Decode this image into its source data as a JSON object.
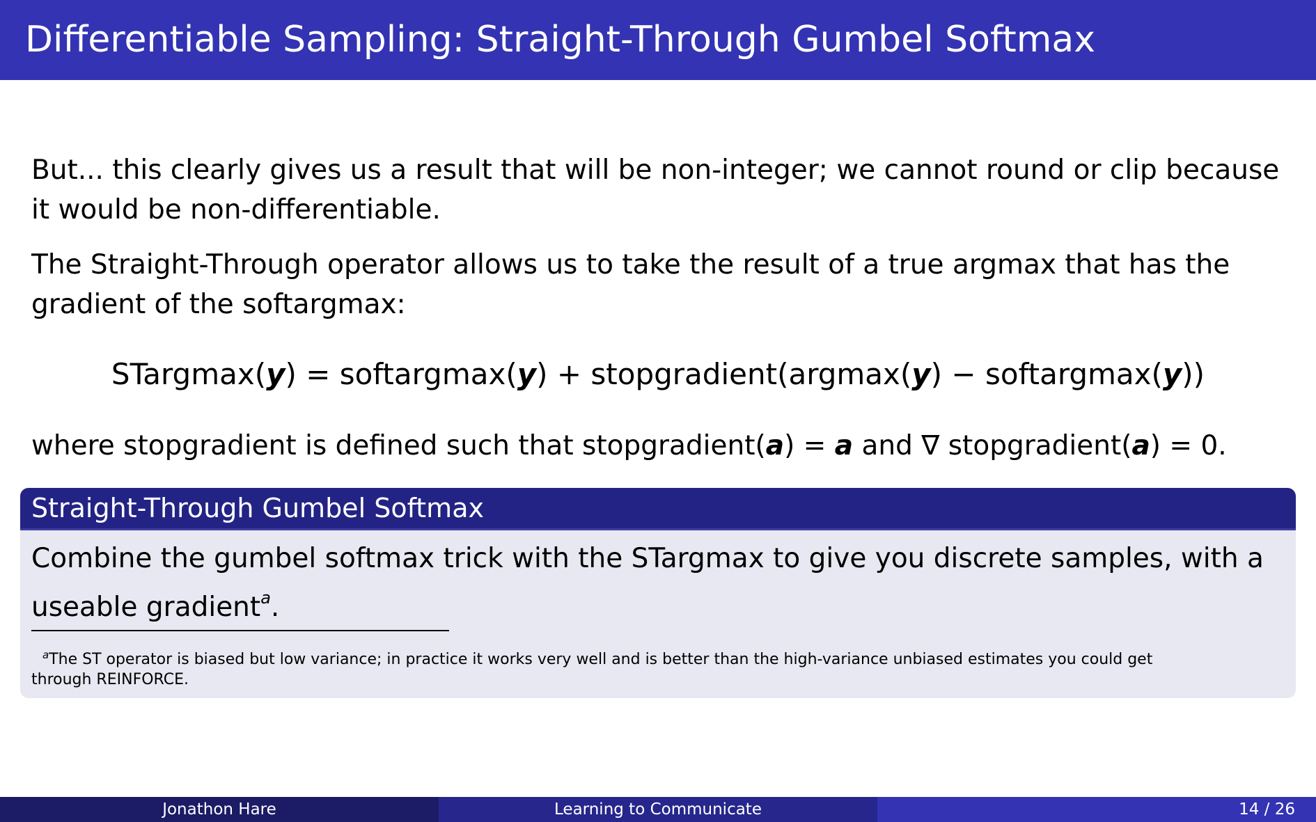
{
  "slide": {
    "title": "Differentiable Sampling: Straight-Through Gumbel Softmax",
    "para1": "But... this clearly gives us a result that will be non-integer; we cannot round or clip because it would be non-differentiable.",
    "para2": "The Straight-Through operator allows us to take the result of a true argmax that has the gradient of the softargmax:"
  },
  "equation": {
    "lhs_fn": "STargmax",
    "var": "y",
    "softargmax": "softargmax",
    "stopgradient": "stopgradient",
    "argmax": "argmax",
    "plus": "+",
    "minus": "−",
    "equals": "="
  },
  "where": {
    "prefix": "where stopgradient is defined such that stopgradient(",
    "var": "a",
    "mid1": ") = ",
    "mid2": " and ∇ stopgradient(",
    "suffix": ") = 0."
  },
  "block": {
    "title": "Straight-Through Gumbel Softmax",
    "body": "Combine the gumbel softmax trick with the STargmax to give you discrete samples, with a useable gradient",
    "marker": "a",
    "body_end": ".",
    "footnote": "The ST operator is biased but low variance; in practice it works very well and is better than the high-variance unbiased estimates you could get through REINFORCE."
  },
  "footer": {
    "author": "Jonathon Hare",
    "talk": "Learning to Communicate",
    "page": "14 / 26"
  },
  "colors": {
    "header": "#3333b3",
    "block_title": "#232385",
    "block_body": "#e8e8f2",
    "footer_left": "#1b1b66",
    "footer_mid": "#26268c",
    "footer_right": "#3333b3"
  }
}
